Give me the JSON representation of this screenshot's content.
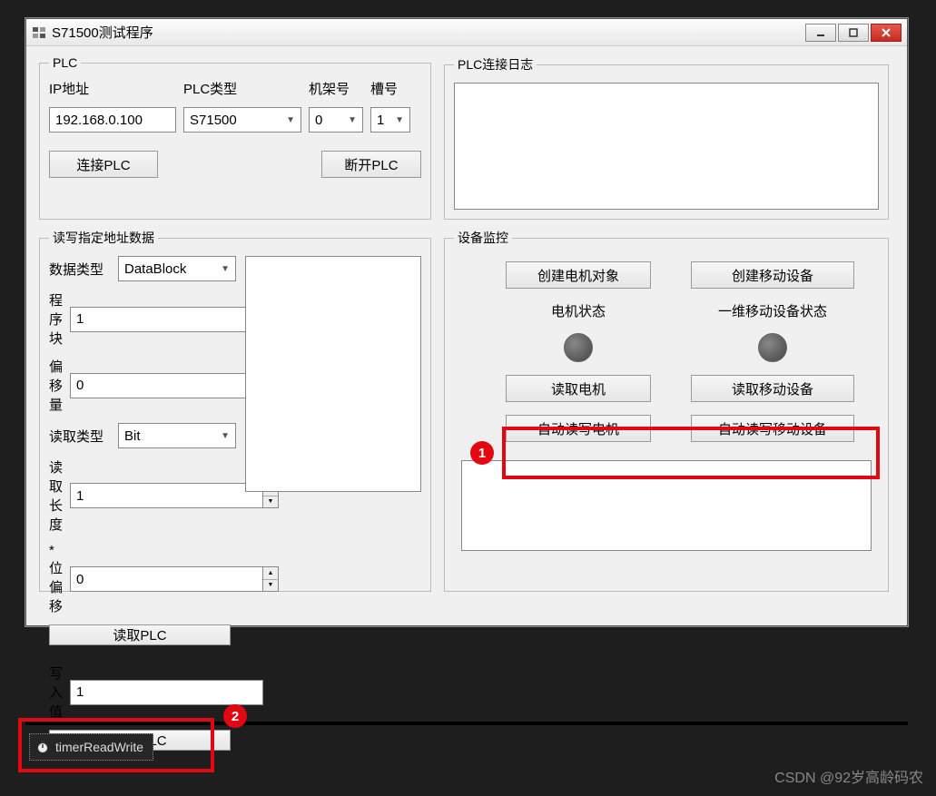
{
  "window": {
    "title": "S71500测试程序"
  },
  "plc": {
    "legend": "PLC",
    "ip_label": "IP地址",
    "ip_value": "192.168.0.100",
    "type_label": "PLC类型",
    "type_value": "S71500",
    "rack_label": "机架号",
    "rack_value": "0",
    "slot_label": "槽号",
    "slot_value": "1",
    "connect_btn": "连接PLC",
    "disconnect_btn": "断开PLC"
  },
  "log": {
    "legend": "PLC连接日志"
  },
  "rw": {
    "legend": "读写指定地址数据",
    "datatype_label": "数据类型",
    "datatype_value": "DataBlock",
    "block_label": "程序块",
    "block_value": "1",
    "offset_label": "偏移量",
    "offset_value": "0",
    "readtype_label": "读取类型",
    "readtype_value": "Bit",
    "readlen_label": "读取长度",
    "readlen_value": "1",
    "bitoffset_label": "*位偏移",
    "bitoffset_value": "0",
    "read_btn": "读取PLC",
    "writeval_label": "写入值",
    "writeval_value": "1",
    "write_btn": "写入PLC"
  },
  "monitor": {
    "legend": "设备监控",
    "create_motor_btn": "创建电机对象",
    "create_move_btn": "创建移动设备",
    "motor_status_label": "电机状态",
    "move_status_label": "一维移动设备状态",
    "read_motor_btn": "读取电机",
    "read_move_btn": "读取移动设备",
    "auto_motor_btn": "自动读写电机",
    "auto_move_btn": "自动读写移动设备"
  },
  "annotations": {
    "badge1": "1",
    "badge2": "2"
  },
  "tray": {
    "timer_name": "timerReadWrite"
  },
  "watermark": "CSDN @92岁高龄码农"
}
